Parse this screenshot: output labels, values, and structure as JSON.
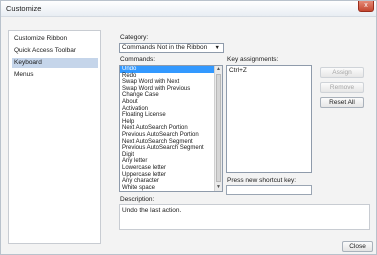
{
  "window": {
    "title": "Customize",
    "close_glyph": "x"
  },
  "sidebar": {
    "items": [
      {
        "label": "Customize Ribbon",
        "active": false
      },
      {
        "label": "Quick Access Toolbar",
        "active": false
      },
      {
        "label": "Keyboard",
        "active": true
      },
      {
        "label": "Menus",
        "active": false
      }
    ]
  },
  "category": {
    "label": "Category:",
    "selected": "Commands Not in the Ribbon"
  },
  "commands": {
    "label": "Commands:",
    "items": [
      "Undo",
      "Redo",
      "Swap Word with Next",
      "Swap Word with Previous",
      "Change Case",
      "About",
      "Activation",
      "Floating License",
      "Help",
      "Next AutoSearch Portion",
      "Previous AutoSearch Portion",
      "Next AutoSearch Segment",
      "Previous AutoSearch Segment",
      "Digit",
      "Any letter",
      "Lowercase letter",
      "Uppercase letter",
      "Any character",
      "White space"
    ],
    "selected_index": 0
  },
  "key_assignments": {
    "label": "Key assignments:",
    "items": [
      "Ctrl+Z"
    ]
  },
  "buttons": {
    "assign": "Assign",
    "remove": "Remove",
    "reset_all": "Reset All",
    "close": "Close"
  },
  "shortcut": {
    "label": "Press new shortcut key:",
    "value": ""
  },
  "description": {
    "label": "Description:",
    "text": "Undo the last action."
  }
}
